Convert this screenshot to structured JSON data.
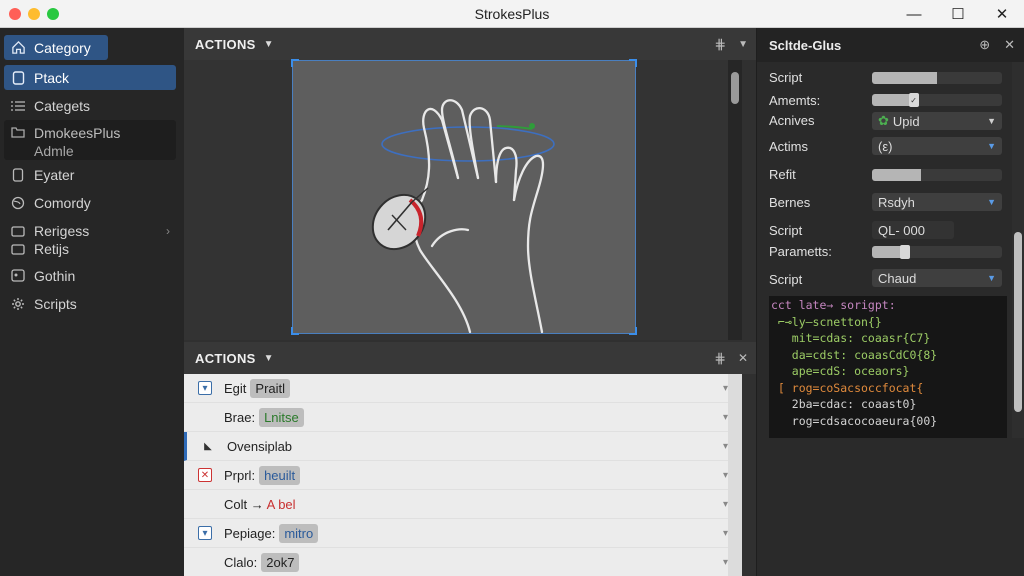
{
  "window": {
    "title": "StrokesPlus",
    "minimize_glyph": "—",
    "maximize_glyph": "☐",
    "close_glyph": "✕"
  },
  "sidebar": {
    "items": [
      {
        "label": "Category",
        "icon": "home-icon"
      },
      {
        "label": "Ptack",
        "icon": "square-icon"
      },
      {
        "label": "Categets",
        "icon": "list-icon"
      },
      {
        "label": "DmokeesPlus",
        "sublabel": "Admle",
        "icon": "folder-icon"
      },
      {
        "label": "Eyater",
        "icon": "square-icon"
      },
      {
        "label": "Comordy",
        "icon": "globe-icon"
      },
      {
        "label": "Rerigess",
        "icon": "folder-icon"
      },
      {
        "label": "Retijs",
        "icon": "folder-icon"
      },
      {
        "label": "Gothin",
        "icon": "gallery-icon"
      },
      {
        "label": "Scripts",
        "icon": "gear-icon"
      }
    ]
  },
  "center": {
    "top_header": "ACTIONS",
    "bottom_header": "ACTIONS",
    "rows": [
      {
        "label": "Egit",
        "value": "Praitl",
        "check": "check"
      },
      {
        "label": "Brae:",
        "value": "Lnitse",
        "check": ""
      },
      {
        "label": "Ovensiplab",
        "value": "",
        "check": "cursor"
      },
      {
        "label": "Prprl:",
        "value": "heuilt",
        "check": "x"
      },
      {
        "label": "Colt →",
        "value": "A bel",
        "check": ""
      },
      {
        "label": "Pepiage:",
        "value": "mitro",
        "check": "check"
      },
      {
        "label": "Clalo:",
        "value": "2ok7",
        "check": ""
      }
    ]
  },
  "right": {
    "title": "Scltde-Glus",
    "props": [
      {
        "label": "Script",
        "type": "bar",
        "value": 0.5
      },
      {
        "label": "Amemts:",
        "type": "slider",
        "value": 0.32
      },
      {
        "label": "Acnives",
        "type": "select",
        "value": "Upid"
      },
      {
        "label": "Actims",
        "type": "select",
        "value": "(ε)"
      },
      {
        "label": "Refit",
        "type": "bar",
        "value": 0.38
      },
      {
        "label": "Bernes",
        "type": "select",
        "value": "Rsdyh"
      },
      {
        "label": "Script",
        "type": "text",
        "value": "QL- 000"
      },
      {
        "label": "Parametts:",
        "type": "slider",
        "value": 0.25
      },
      {
        "label": "Script",
        "type": "select",
        "value": "Chaud"
      }
    ],
    "code_lines": [
      "cct late→ sorigpt:",
      " ⌐⊸ly—scnetton{}",
      "   mit=cdas: coaasr{C7}",
      "   da=cdst: coaasCdC0{8}",
      "   ape=cdS: oceaors}",
      "",
      " [ rog=coSacsoccfocat{",
      "   2ba=cdac: coaast0}",
      "   rog=cdsacocoaeura{00}"
    ]
  }
}
